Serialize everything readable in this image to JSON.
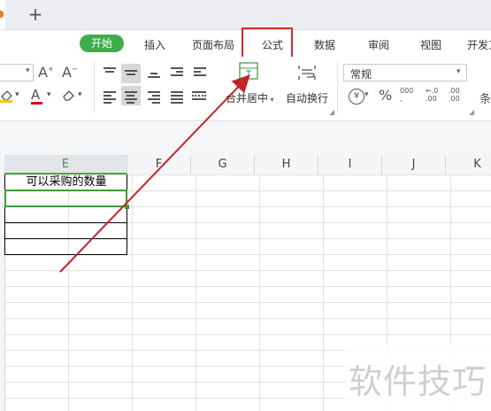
{
  "tabstrip": {
    "new_tab": "+"
  },
  "menu": {
    "start": "开始",
    "insert": "插入",
    "page_layout": "页面布局",
    "formula": "公式",
    "data": "数据",
    "review": "审阅",
    "view": "视图",
    "developer": "开发工"
  },
  "ribbon": {
    "merge_center": "合并居中",
    "wrap_text": "自动换行",
    "number_format": "常规",
    "font_grow": "A",
    "font_shrink": "A",
    "font_color": "A",
    "percent": "%",
    "thousands": "000",
    "inc_decimal": ".00",
    "dec_decimal": ".00",
    "cond_format": "条"
  },
  "sheet": {
    "columns": [
      "E",
      "F",
      "G",
      "H",
      "I",
      "J",
      "K"
    ],
    "cell_e1": "可以采购的数量"
  },
  "colors": {
    "accent": "#3fae4a",
    "highlight": "#d72a2a",
    "orange": "#f07b1e"
  },
  "watermark": "软件技巧"
}
